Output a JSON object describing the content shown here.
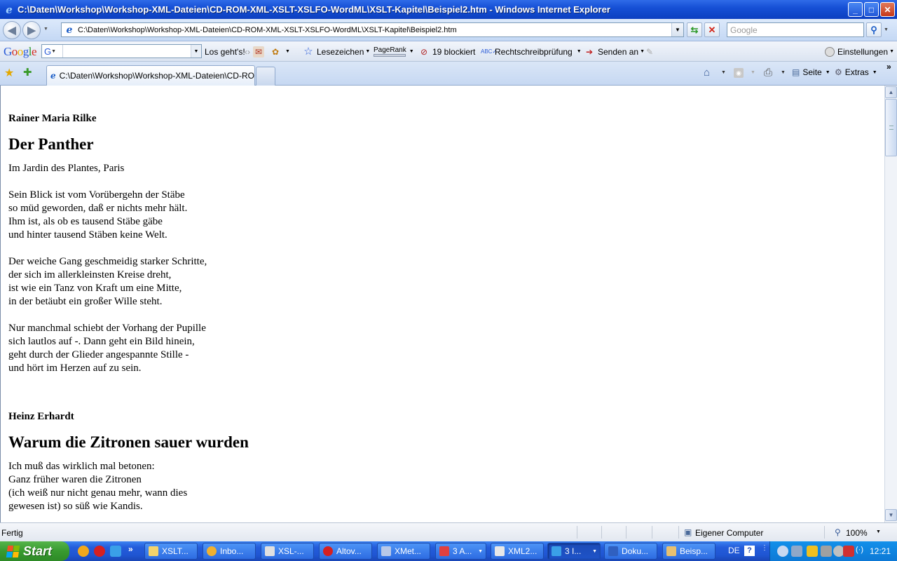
{
  "window": {
    "title": "C:\\Daten\\Workshop\\Workshop-XML-Dateien\\CD-ROM-XML-XSLT-XSLFO-WordML\\XSLT-Kapitel\\Beispiel2.htm - Windows Internet Explorer",
    "min_label": "_",
    "max_label": "□",
    "close_label": "✕"
  },
  "address_bar": {
    "url": "C:\\Daten\\Workshop\\Workshop-XML-Dateien\\CD-ROM-XML-XSLT-XSLFO-WordML\\XSLT-Kapitel\\Beispiel2.htm",
    "search_placeholder": "Google"
  },
  "google_toolbar": {
    "logo": "Google",
    "search_value": "",
    "go_label": "Los geht's!",
    "bookmarks_label": "Lesezeichen",
    "pagerank_label": "PageRank",
    "blocked_label": "19 blockiert",
    "spellcheck_label": "Rechtschreibprüfung",
    "send_label": "Senden an",
    "settings_label": "Einstellungen"
  },
  "tabs": {
    "active_label": "C:\\Daten\\Workshop\\Workshop-XML-Dateien\\CD-ROM...",
    "page_label": "Seite",
    "extras_label": "Extras",
    "more_label": "»"
  },
  "content": {
    "poems": [
      {
        "author": "Rainer Maria Rilke",
        "title": "Der Panther",
        "subtitle": "Im Jardin des Plantes, Paris",
        "stanzas": [
          "Sein Blick ist vom Vorübergehn der Stäbe\nso müd geworden, daß er nichts mehr hält.\nIhm ist, als ob es tausend Stäbe gäbe\nund hinter tausend Stäben keine Welt.",
          "Der weiche Gang geschmeidig starker Schritte,\nder sich im allerkleinsten Kreise dreht,\nist wie ein Tanz von Kraft um eine Mitte,\nin der betäubt ein großer Wille steht.",
          "Nur manchmal schiebt der Vorhang der Pupille\nsich lautlos auf -. Dann geht ein Bild hinein,\ngeht durch der Glieder angespannte Stille -\nund hört im Herzen auf zu sein."
        ]
      },
      {
        "author": "Heinz Erhardt",
        "title": "Warum die Zitronen sauer wurden",
        "stanzas": [
          "Ich muß das wirklich mal betonen:\nGanz früher waren die Zitronen\n(ich weiß nur nicht genau mehr, wann dies\ngewesen ist) so süß wie Kandis."
        ]
      }
    ]
  },
  "status_bar": {
    "status": "Fertig",
    "zone": "Eigener Computer",
    "zoom": "100%"
  },
  "taskbar": {
    "start_label": "Start",
    "quick_more": "»",
    "tasks": [
      {
        "label": "XSLT..."
      },
      {
        "label": "Inbo..."
      },
      {
        "label": "XSL-..."
      },
      {
        "label": "Altov..."
      },
      {
        "label": "XMet..."
      },
      {
        "label": "3 A..."
      },
      {
        "label": "XML2..."
      },
      {
        "label": "3 I..."
      },
      {
        "label": "Doku..."
      },
      {
        "label": "Beisp..."
      }
    ],
    "lang": "DE",
    "help": "?",
    "clock": "12:21"
  },
  "colors": {
    "titlebar": "#1650d6",
    "taskbar": "#245ddb",
    "start": "#389a2f"
  }
}
